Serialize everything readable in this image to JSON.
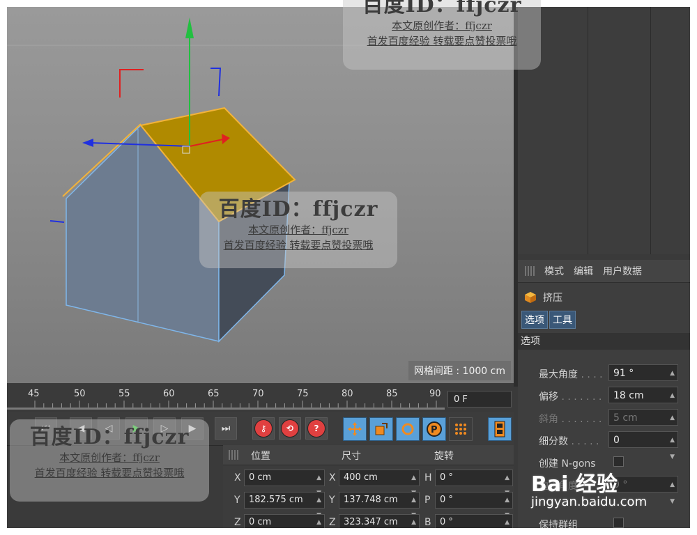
{
  "viewport": {
    "grid_spacing_label": "网格间距 : 1000 cm"
  },
  "attributes": {
    "menu": [
      "模式",
      "编辑",
      "用户数据"
    ],
    "object_name": "挤压",
    "tabs": [
      "选项",
      "工具"
    ],
    "section_title": "选项",
    "props": [
      {
        "label": "最大角度",
        "value": "91 °"
      },
      {
        "label": "偏移",
        "value": "18 cm"
      },
      {
        "label": "斜角",
        "value": "5 cm"
      },
      {
        "label": "细分数",
        "value": "0"
      },
      {
        "label": "创建 N-gons",
        "value": ""
      },
      {
        "label": "边缘角度",
        "value": "0 °"
      },
      {
        "label": "保持群组",
        "value": ""
      }
    ]
  },
  "timeline": {
    "ticks": [
      "45",
      "50",
      "55",
      "60",
      "65",
      "70",
      "75",
      "80",
      "85",
      "90"
    ],
    "current_frame": "0 F"
  },
  "coordinates": {
    "headers": [
      "位置",
      "尺寸",
      "旋转"
    ],
    "rows": [
      {
        "pos_axis": "X",
        "pos": "0 cm",
        "size_axis": "X",
        "size": "400 cm",
        "rot_axis": "H",
        "rot": "0 °"
      },
      {
        "pos_axis": "Y",
        "pos": "182.575 cm",
        "size_axis": "Y",
        "size": "137.748 cm",
        "rot_axis": "P",
        "rot": "0 °"
      },
      {
        "pos_axis": "Z",
        "pos": "0 cm",
        "size_axis": "Z",
        "size": "323.347 cm",
        "rot_axis": "B",
        "rot": "0 °"
      }
    ]
  },
  "watermark": {
    "title": "百度ID：ffjczr",
    "line1": "本文原创作者：ffjczr",
    "line2": "首发百度经验 转载要点赞投票哦"
  },
  "baidu_logo": {
    "brand": "Bai 经验",
    "url": "jingyan.baidu.com"
  },
  "colors": {
    "roof_selected": "#b08a00",
    "house_wall": "#6d7c90",
    "accent_blue": "#5aa0d8",
    "axis_green": "#22c040",
    "axis_red": "#e02020",
    "axis_blue": "#2030e0"
  }
}
